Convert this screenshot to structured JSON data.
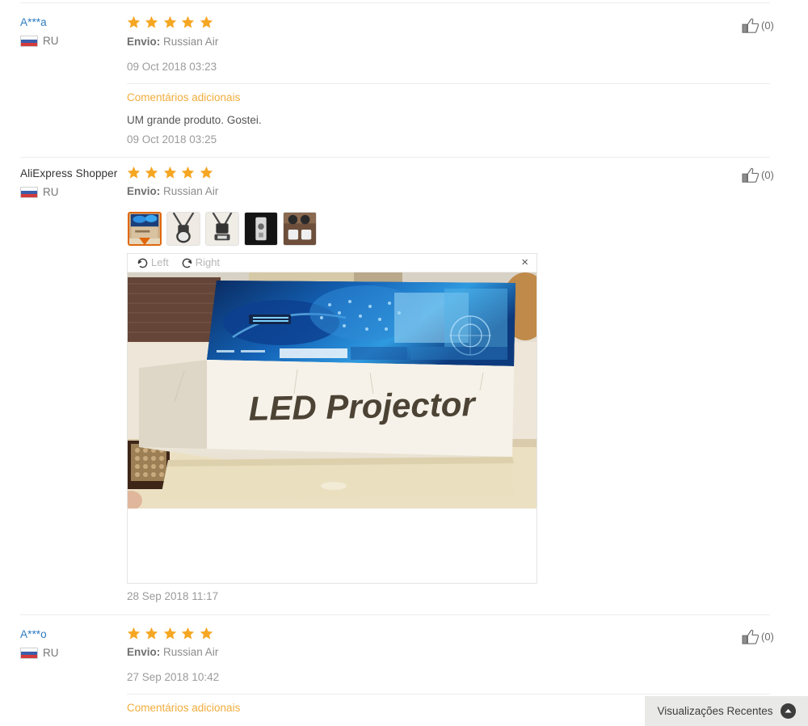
{
  "reviews": [
    {
      "reviewer": "A***a",
      "country_code": "RU",
      "country_flag": "ru-flag-icon",
      "rating": 5,
      "shipping_label": "Envio:",
      "shipping_method": "Russian Air",
      "date": "09 Oct 2018 03:23",
      "additional_title": "Comentários adicionais",
      "additional_text": "UM grande produto. Gostei.",
      "additional_date": "09 Oct 2018 03:25",
      "like_count": "(0)",
      "like_icon": "thumbs-up-icon"
    },
    {
      "reviewer": "AliExpress Shopper",
      "country_code": "RU",
      "country_flag": "ru-flag-icon",
      "rating": 5,
      "shipping_label": "Envio:",
      "shipping_method": "Russian Air",
      "date": "28 Sep 2018 11:17",
      "like_count": "(0)",
      "like_icon": "thumbs-up-icon",
      "thumbnails": [
        {
          "alt": "LED Projector box photo",
          "selected": true
        },
        {
          "alt": "Headset photo 1",
          "selected": false
        },
        {
          "alt": "Headset photo 2",
          "selected": false
        },
        {
          "alt": "Device front photo",
          "selected": false
        },
        {
          "alt": "Accessories photo",
          "selected": false
        }
      ],
      "viewer": {
        "rotate_left_label": "Left",
        "rotate_right_label": "Right",
        "rotate_left_icon": "rotate-left-icon",
        "rotate_right_icon": "rotate-right-icon",
        "close_icon": "close-icon",
        "close_label": "×",
        "image_alt": "LED Projector cardboard box on a table",
        "image_text": "LED Projector"
      }
    },
    {
      "reviewer": "A***o",
      "country_code": "RU",
      "country_flag": "ru-flag-icon",
      "rating": 5,
      "shipping_label": "Envio:",
      "shipping_method": "Russian Air",
      "date": "27 Sep 2018 10:42",
      "additional_title": "Comentários adicionais",
      "like_count": "(0)",
      "like_icon": "thumbs-up-icon"
    }
  ],
  "recent_views": {
    "label": "Visualizações Recentes",
    "icon": "chevron-up-circle-icon"
  },
  "colors": {
    "star": "#f5a623",
    "link": "#2e7bc0",
    "accent_orange": "#f0ad3c",
    "thumb_selected_border": "#e0670c",
    "divider": "#ececec",
    "recent_bar_bg": "#e9e9e7"
  }
}
